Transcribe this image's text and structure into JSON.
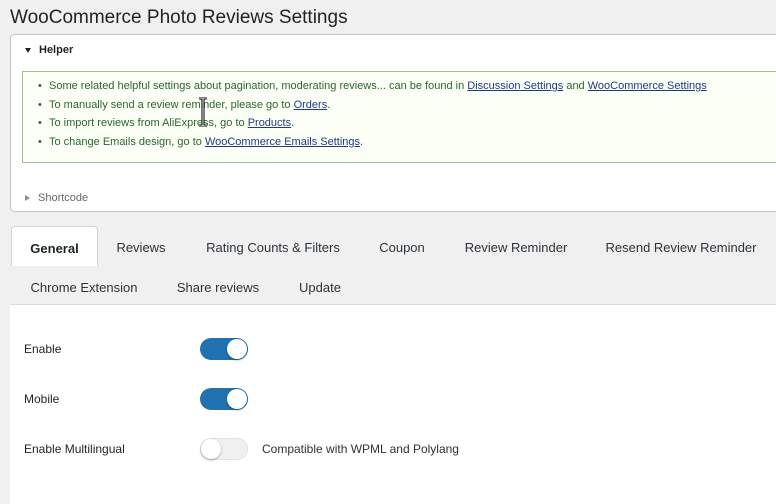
{
  "page": {
    "title": "WooCommerce Photo Reviews Settings"
  },
  "helper": {
    "title": "Helper",
    "notices": [
      {
        "text": "Some related helpful settings about pagination, moderating reviews... can be found in ",
        "link1": "Discussion Settings",
        "mid": " and ",
        "link2": "WooCommerce Settings"
      },
      {
        "text": "To manually send a review reminder, please go to ",
        "link": "Orders",
        "end": "."
      },
      {
        "text": "To import reviews from AliExpress, go to ",
        "link": "Products",
        "end": "."
      },
      {
        "text": "To change Emails design, go to ",
        "link": "WooCommerce Emails Settings",
        "end": "."
      }
    ],
    "shortcode_title": "Shortcode"
  },
  "tabs": [
    {
      "label": "General",
      "active": true
    },
    {
      "label": "Reviews"
    },
    {
      "label": "Rating Counts & Filters"
    },
    {
      "label": "Coupon"
    },
    {
      "label": "Review Reminder"
    },
    {
      "label": "Resend Review Reminder"
    },
    {
      "label": "Chrome Extension"
    },
    {
      "label": "Share reviews"
    },
    {
      "label": "Update"
    }
  ],
  "settings": [
    {
      "label": "Enable",
      "value": true
    },
    {
      "label": "Mobile",
      "value": true
    },
    {
      "label": "Enable Multilingual",
      "value": false,
      "hint": "Compatible with WPML and Polylang"
    }
  ],
  "colors": {
    "accent": "#2271b1",
    "notice_bg": "#fcfff5",
    "notice_text": "#2c662d",
    "link": "#1e3a8a"
  }
}
